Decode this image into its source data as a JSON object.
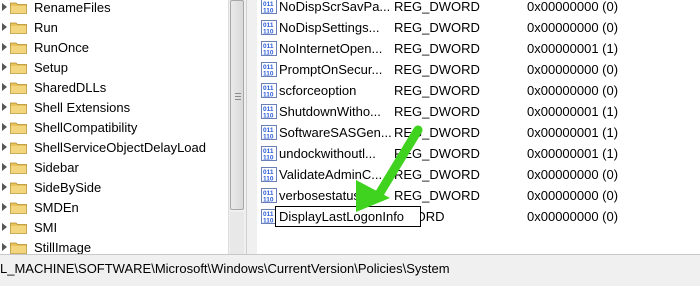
{
  "tree": {
    "items": [
      {
        "label": "RenameFiles"
      },
      {
        "label": "Run"
      },
      {
        "label": "RunOnce"
      },
      {
        "label": "Setup"
      },
      {
        "label": "SharedDLLs"
      },
      {
        "label": "Shell Extensions"
      },
      {
        "label": "ShellCompatibility"
      },
      {
        "label": "ShellServiceObjectDelayLoad"
      },
      {
        "label": "Sidebar"
      },
      {
        "label": "SideBySide"
      },
      {
        "label": "SMDEn"
      },
      {
        "label": "SMI"
      },
      {
        "label": "StillImage"
      }
    ]
  },
  "values": {
    "rows": [
      {
        "name": "NoDispScrSavPa...",
        "type": "REG_DWORD",
        "data": "0x00000000 (0)"
      },
      {
        "name": "NoDispSettings...",
        "type": "REG_DWORD",
        "data": "0x00000000 (0)"
      },
      {
        "name": "NoInternetOpen...",
        "type": "REG_DWORD",
        "data": "0x00000001 (1)"
      },
      {
        "name": "PromptOnSecur...",
        "type": "REG_DWORD",
        "data": "0x00000000 (0)"
      },
      {
        "name": "scforceoption",
        "type": "REG_DWORD",
        "data": "0x00000000 (0)"
      },
      {
        "name": "ShutdownWitho...",
        "type": "REG_DWORD",
        "data": "0x00000001 (1)"
      },
      {
        "name": "SoftwareSASGen...",
        "type": "REG_DWORD",
        "data": "0x00000001 (1)"
      },
      {
        "name": "undockwithoutl...",
        "type": "REG_DWORD",
        "data": "0x00000001 (1)"
      },
      {
        "name": "ValidateAdminC...",
        "type": "REG_DWORD",
        "data": "0x00000000 (0)"
      },
      {
        "name": "verbosestatus",
        "type": "REG_DWORD",
        "data": "0x00000000 (0)"
      },
      {
        "name": "",
        "type": "DWORD",
        "data": "0x00000000 (0)"
      }
    ],
    "rename_value": "DisplayLastLogonInfo"
  },
  "statusbar": {
    "path": "L_MACHINE\\SOFTWARE\\Microsoft\\Windows\\CurrentVersion\\Policies\\System"
  },
  "colors": {
    "folder": "#e8c35a",
    "arrow": "#3fd21e",
    "reg_icon": "#2a5bd7"
  },
  "icons": {
    "tree_folder": "folder-icon",
    "value_type": "reg-dword-icon",
    "annotation": "green-arrow-icon"
  }
}
